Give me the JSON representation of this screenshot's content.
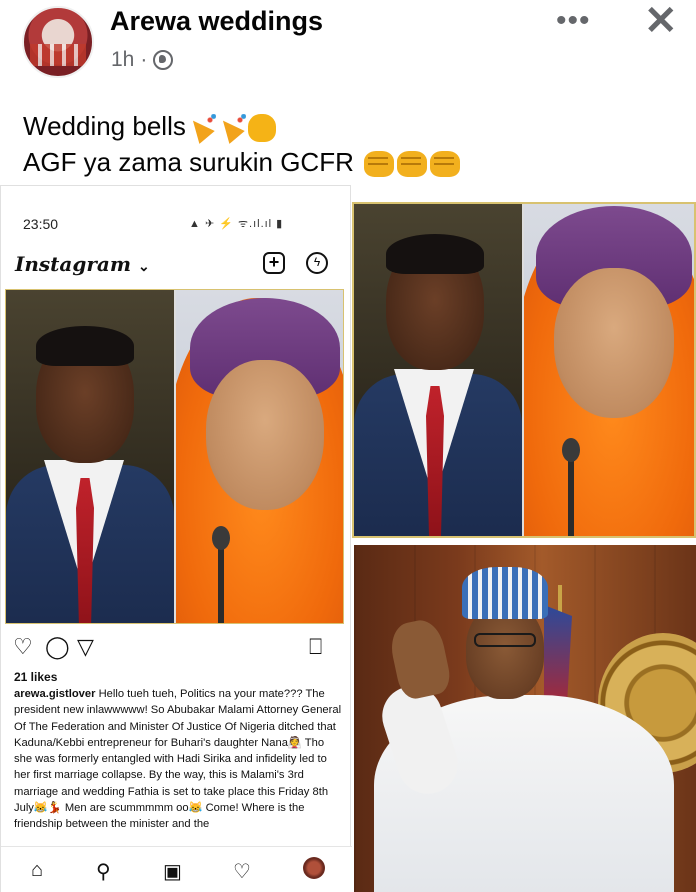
{
  "post": {
    "page_name": "Arewa weddings",
    "time": "1h",
    "separator": "·",
    "more_label": "•••",
    "close_label": "✕",
    "text_line1": "Wedding bells",
    "text_line2": "AGF ya zama surukin GCFR"
  },
  "instagram": {
    "status_time": "23:50",
    "status_icons": "▲ ✈ ⚡ ᯤ.ıl.ıl ▮",
    "logo": "Instagram",
    "logo_caret": "⌄",
    "likes": "21 likes",
    "username": "arewa.gistlover",
    "caption": "Hello tueh tueh, Politics na your mate??? The president new inlawwwww! So Abubakar Malami Attorney General Of The Federation and Minister Of Justice Of Nigeria ditched that Kaduna/Kebbi entrepreneur for Buhari's daughter Nana👰 Tho she was formerly entangled with Hadi Sirika and infidelity led to her first marriage collapse. By the way, this is Malami's 3rd marriage and wedding Fathia is set to take place this Friday 8th July😹💃 Men are scummmmm oo😹 Come! Where is the friendship between the minister and the"
  },
  "icons": {
    "globe": "globe-icon",
    "more": "more-icon",
    "close": "close-icon",
    "heart": "heart-icon",
    "comment": "comment-icon",
    "share": "share-icon",
    "bookmark": "bookmark-icon",
    "home": "home-icon",
    "search": "search-icon",
    "reels": "reels-icon",
    "shop": "shop-icon"
  }
}
